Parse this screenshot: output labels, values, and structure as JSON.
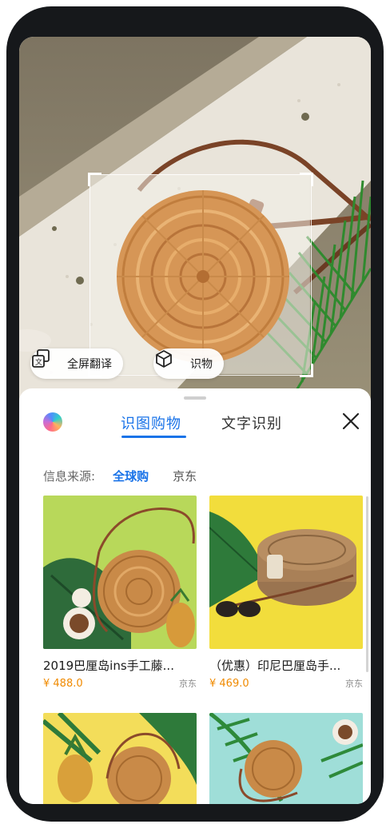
{
  "camera": {
    "actions": [
      {
        "label": "全屏翻译",
        "icon": "translate-icon"
      },
      {
        "label": "识物",
        "icon": "cube-icon"
      }
    ]
  },
  "panel": {
    "tabs": [
      {
        "label": "识图购物",
        "active": true
      },
      {
        "label": "文字识别",
        "active": false
      }
    ],
    "source_label": "信息来源:",
    "sources": [
      {
        "label": "全球购",
        "selected": true
      },
      {
        "label": "京东",
        "selected": false
      }
    ],
    "accent_color": "#1a73e8",
    "price_color": "#f08a00"
  },
  "products": [
    {
      "title": "2019巴厘岛ins手工藤...",
      "price": "¥ 488.0",
      "store": "京东"
    },
    {
      "title": "（优惠）印尼巴厘岛手...",
      "price": "¥ 469.0",
      "store": "京东"
    },
    {
      "title": "",
      "price": "",
      "store": ""
    },
    {
      "title": "",
      "price": "",
      "store": ""
    }
  ]
}
